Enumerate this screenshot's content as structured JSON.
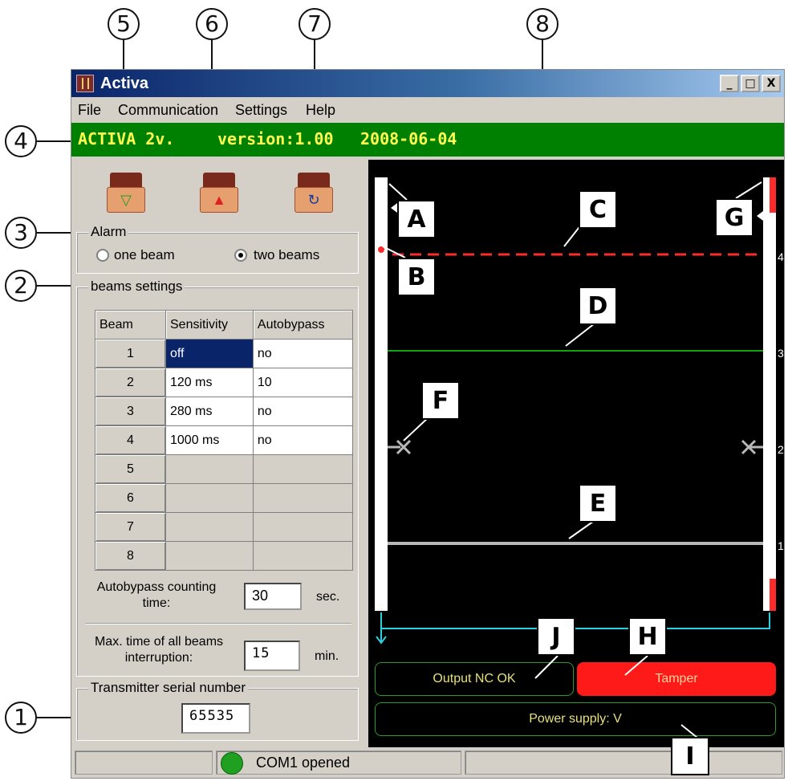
{
  "callouts": [
    "1",
    "2",
    "3",
    "4",
    "5",
    "6",
    "7",
    "8"
  ],
  "window": {
    "title": "Activa",
    "min_glyph": "_",
    "max_glyph": "□",
    "close_glyph": "X"
  },
  "menu": {
    "items": [
      "File",
      "Communication",
      "Settings",
      "Help"
    ]
  },
  "banner": {
    "model": "ACTIVA 2v.",
    "version": "version:1.00",
    "date": "2008-06-04",
    "text_color": "#ffff50",
    "bg_color": "#008000"
  },
  "toolbar": {
    "icons": [
      "download-settings-icon",
      "upload-settings-icon",
      "reset-settings-icon"
    ]
  },
  "alarm": {
    "legend": "Alarm",
    "options": [
      {
        "label": "one beam",
        "checked": false
      },
      {
        "label": "two beams",
        "checked": true
      }
    ]
  },
  "beams": {
    "legend": "beams settings",
    "columns": [
      "Beam",
      "Sensitivity",
      "Autobypass"
    ],
    "rows": [
      {
        "beam": "1",
        "sensitivity": "off",
        "autobypass": "no"
      },
      {
        "beam": "2",
        "sensitivity": "120 ms",
        "autobypass": "10"
      },
      {
        "beam": "3",
        "sensitivity": "280 ms",
        "autobypass": "no"
      },
      {
        "beam": "4",
        "sensitivity": "1000 ms",
        "autobypass": "no"
      },
      {
        "beam": "5",
        "sensitivity": "",
        "autobypass": ""
      },
      {
        "beam": "6",
        "sensitivity": "",
        "autobypass": ""
      },
      {
        "beam": "7",
        "sensitivity": "",
        "autobypass": ""
      },
      {
        "beam": "8",
        "sensitivity": "",
        "autobypass": ""
      }
    ]
  },
  "autobypass_time": {
    "label_line1": "Autobypass counting",
    "label_line2": "time:",
    "value": "30",
    "unit": "sec."
  },
  "max_interruption": {
    "label_line1": "Max. time of all beams",
    "label_line2": "interruption:",
    "value": "15",
    "unit": "min."
  },
  "transmitter": {
    "legend": "Transmitter serial number",
    "value": "65535"
  },
  "statusbar": {
    "text": "COM1 opened",
    "led_color": "#20a020"
  },
  "panel": {
    "annotations": [
      "A",
      "B",
      "C",
      "D",
      "E",
      "F",
      "G",
      "H",
      "I",
      "J"
    ],
    "tick_labels": [
      "4",
      "3",
      "2",
      "1"
    ],
    "output_status": "Output NC OK",
    "tamper_status": "Tamper",
    "power_supply": "Power supply: V",
    "colors": {
      "beam_broken": "#ff2a2a",
      "beam_ok": "#14a014",
      "beam_bypassed": "#b8b8b8",
      "cable": "#2ad0e0",
      "tamper_bg": "#ff1a1a"
    }
  }
}
